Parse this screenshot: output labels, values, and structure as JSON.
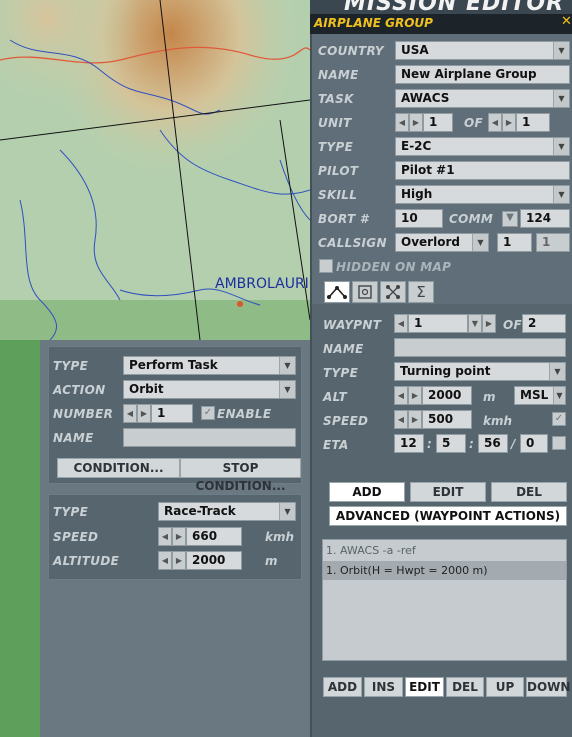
{
  "header": {
    "title": "MISSION EDITOR",
    "close_glyph": "✕"
  },
  "map": {
    "town_label": "AMBROLAURI"
  },
  "action_panel": {
    "type_label": "TYPE",
    "type_value": "Perform Task",
    "action_label": "ACTION",
    "action_value": "Orbit",
    "number_label": "NUMBER",
    "number_value": "1",
    "enable_label": "ENABLE",
    "name_label": "NAME",
    "name_value": "",
    "condition_btn": "CONDITION...",
    "stop_condition_btn": "STOP CONDITION..."
  },
  "orbit_panel": {
    "type_label": "TYPE",
    "type_value": "Race-Track",
    "speed_label": "SPEED",
    "speed_value": "660",
    "speed_unit": "kmh",
    "altitude_label": "ALTITUDE",
    "altitude_value": "2000",
    "altitude_unit": "m"
  },
  "group": {
    "title": "AIRPLANE GROUP",
    "country_label": "COUNTRY",
    "country_value": "USA",
    "name_label": "NAME",
    "name_value": "New Airplane Group",
    "task_label": "TASK",
    "task_value": "AWACS",
    "unit_label": "UNIT",
    "unit_value": "1",
    "of_label": "OF",
    "unit_total": "1",
    "type_label": "TYPE",
    "type_value": "E-2C",
    "pilot_label": "PILOT",
    "pilot_value": "Pilot #1",
    "skill_label": "SKILL",
    "skill_value": "High",
    "bort_label": "BORT #",
    "bort_value": "10",
    "comm_label": "COMM",
    "comm_value": "124",
    "callsign_label": "CALLSIGN",
    "callsign_value": "Overlord",
    "callsign_n1": "1",
    "callsign_n2": "1",
    "hidden_label": "HIDDEN ON MAP"
  },
  "waypoint": {
    "wpt_label": "WAYPNT",
    "wpt_value": "1",
    "of_label": "OF",
    "wpt_total": "2",
    "name_label": "NAME",
    "name_value": "",
    "type_label": "TYPE",
    "type_value": "Turning point",
    "alt_label": "ALT",
    "alt_value": "2000",
    "alt_unit": "m",
    "alt_ref": "MSL",
    "speed_label": "SPEED",
    "speed_value": "500",
    "speed_unit": "kmh",
    "eta_label": "ETA",
    "eta_h": "12",
    "eta_m": "5",
    "eta_s": "56",
    "eta_d": "0",
    "sep_colon": ":",
    "sep_slash": "/",
    "add_btn": "ADD",
    "edit_btn": "EDIT",
    "del_btn": "DEL",
    "advanced_btn": "ADVANCED (WAYPOINT ACTIONS)",
    "actions": [
      "1. AWACS -a -ref",
      "1. Orbit(H = Hwpt = 2000 m)"
    ],
    "bottom_buttons": [
      "ADD",
      "INS",
      "EDIT",
      "DEL",
      "UP",
      "DOWN"
    ]
  },
  "colors": {
    "panel": "#5f6e78",
    "accent": "#f0c020"
  }
}
